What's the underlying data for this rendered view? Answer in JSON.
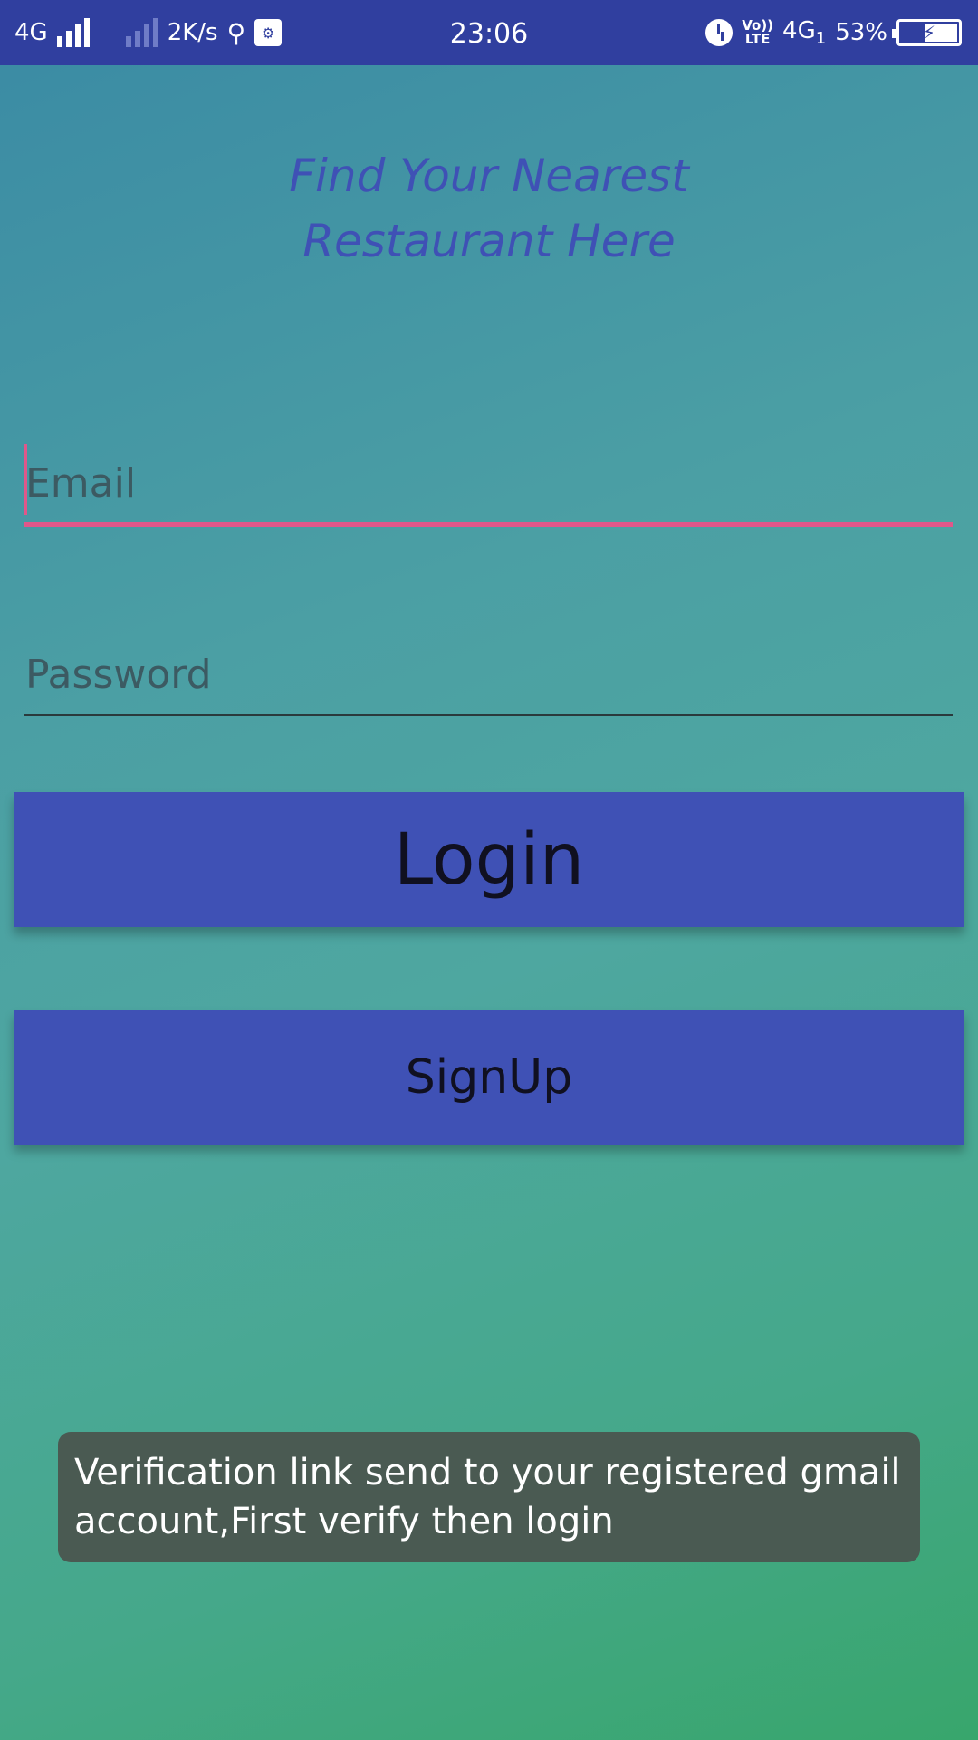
{
  "status_bar": {
    "network_left": "4G",
    "speed": "2K/s",
    "time": "23:06",
    "volte": "Vo))\nLTE",
    "network_right": "4G",
    "sim_index": "1",
    "battery": "53%",
    "icons": [
      "signal-icon",
      "usb-icon",
      "notification-icon",
      "alarm-icon",
      "battery-icon"
    ]
  },
  "headline": {
    "line1": "Find Your Nearest",
    "line2": "Restaurant Here"
  },
  "form": {
    "email_placeholder": "Email",
    "password_placeholder": "Password"
  },
  "buttons": {
    "login": "Login",
    "signup": "SignUp"
  },
  "toast": {
    "line1": "Verification link send to your registered gmail",
    "line2": "account,First verify then login"
  },
  "colors": {
    "status_bar": "#303f9f",
    "primary": "#3f51b5",
    "accent": "#e0578a",
    "toast_bg": "#4a5a52"
  }
}
